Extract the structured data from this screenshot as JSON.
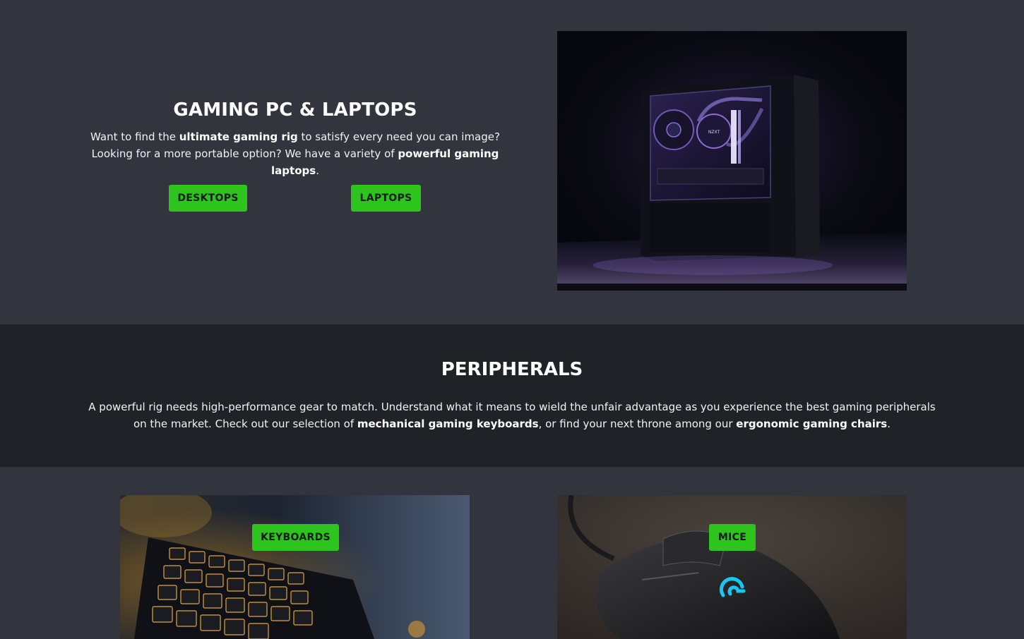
{
  "hero": {
    "title": "GAMING PC & LAPTOPS",
    "desc_1": "Want to find the ",
    "desc_bold_1": "ultimate gaming rig",
    "desc_2": " to satisfy every need you can image? Looking for a more portable option? We have a variety of ",
    "desc_bold_2": "powerful gaming laptops",
    "desc_3": ".",
    "buttons": {
      "desktops": "DESKTOPS",
      "laptops": "LAPTOPS"
    },
    "image_icon": "gaming-pc-photo-icon",
    "case_logo": "NZXT"
  },
  "peripherals": {
    "title": "PERIPHERALS",
    "desc_1": "A powerful rig needs high-performance gear to match. Understand what it means to wield the unfair advantage as you experience the best gaming peripherals on the market. Check out our selection of ",
    "desc_bold_1": "mechanical gaming keyboards",
    "desc_2": ", or find your next throne among our ",
    "desc_bold_2": "ergonomic gaming chairs",
    "desc_3": "."
  },
  "tiles": {
    "keyboards": {
      "label": "KEYBOARDS",
      "image_icon": "keyboard-photo-icon"
    },
    "mice": {
      "label": "MICE",
      "image_icon": "mouse-photo-icon"
    }
  },
  "colors": {
    "page_bg": "#32343e",
    "band_bg": "#212227",
    "accent_green": "#2ec41e",
    "button_text": "#0f1a12",
    "text": "#ffffff",
    "mouse_logo_cyan": "#19c8f2",
    "pc_glow_purple": "#8e6bd6"
  }
}
